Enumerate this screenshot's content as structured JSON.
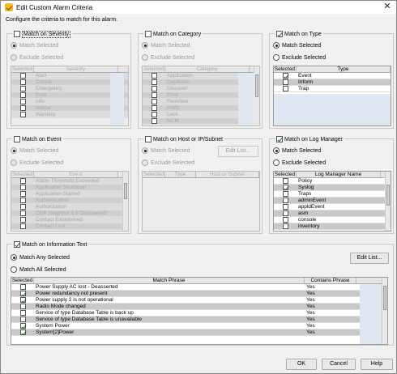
{
  "window": {
    "title": "Edit Custom Alarm Criteria",
    "close_label": "✕"
  },
  "instruction": "Configure the criteria to match for this alarm.",
  "common": {
    "match_selected": "Match Selected",
    "exclude_selected": "Exclude Selected",
    "selected_col": "Selected",
    "edit_list": "Edit List..."
  },
  "severity": {
    "header": "Match on Severity",
    "checked": false,
    "col": "Severity",
    "items": [
      "Alert",
      "Critical",
      "Emergency",
      "Error",
      "Info",
      "Notice",
      "Warning"
    ]
  },
  "category": {
    "header": "Match on Category",
    "checked": false,
    "col": "Category",
    "items": [
      "Application",
      "Database",
      "Discover",
      "Error",
      "FlexView",
      "HWG",
      "Lock",
      "NCM"
    ]
  },
  "type": {
    "header": "Match on Type",
    "checked": true,
    "col": "Type",
    "items": [
      {
        "label": "Event",
        "sel": true
      },
      {
        "label": "Inform",
        "sel": false
      },
      {
        "label": "Trap",
        "sel": false
      }
    ]
  },
  "event": {
    "header": "Match on Event",
    "checked": false,
    "col": "Event",
    "items": [
      "Alarm Threshold Exceeded",
      "Application Shutdown",
      "Application Started",
      "Authentication",
      "Authorization",
      "CDP Neighbor 1.5 Discovered",
      "Contact Established",
      "Contact Lost"
    ]
  },
  "host": {
    "header": "Match on Host or IP/Subnet",
    "checked": false,
    "cols": [
      "Selected",
      "Type",
      "Host or Subnet"
    ]
  },
  "logmgr": {
    "header": "Match on Log Manager",
    "checked": true,
    "col": "Log Manager Name",
    "items": [
      {
        "label": "Policy",
        "sel": false
      },
      {
        "label": "Syslog",
        "sel": true
      },
      {
        "label": "Traps",
        "sel": false
      },
      {
        "label": "adminEvent",
        "sel": false
      },
      {
        "label": "appldEvent",
        "sel": false
      },
      {
        "label": "asm",
        "sel": false
      },
      {
        "label": "console",
        "sel": false
      },
      {
        "label": "inventory",
        "sel": false
      }
    ]
  },
  "infotext": {
    "header": "Match on Information Text",
    "checked": true,
    "match_any": "Match Any Selected",
    "match_all": "Match All Selected",
    "cols": [
      "Selected",
      "Match Phrase",
      "Contains Phrase"
    ],
    "rows": [
      {
        "phrase": "Power Supply AC lost  -  Deasserted",
        "contains": "Yes",
        "sel": false
      },
      {
        "phrase": "Power redundancy not present",
        "contains": "Yes",
        "sel": true
      },
      {
        "phrase": "Power supply 2 is not operational",
        "contains": "Yes",
        "sel": true
      },
      {
        "phrase": "Radio Mode changed",
        "contains": "Yes",
        "sel": false
      },
      {
        "phrase": "Service of type Database Table is back up",
        "contains": "Yes",
        "sel": false
      },
      {
        "phrase": "Service of type Database Table is unavailable",
        "contains": "Yes",
        "sel": false
      },
      {
        "phrase": "System Power",
        "contains": "Yes",
        "sel": true
      },
      {
        "phrase": "System[2]Power",
        "contains": "Yes",
        "sel": true
      }
    ]
  },
  "buttons": {
    "ok": "OK",
    "cancel": "Cancel",
    "help": "Help"
  }
}
